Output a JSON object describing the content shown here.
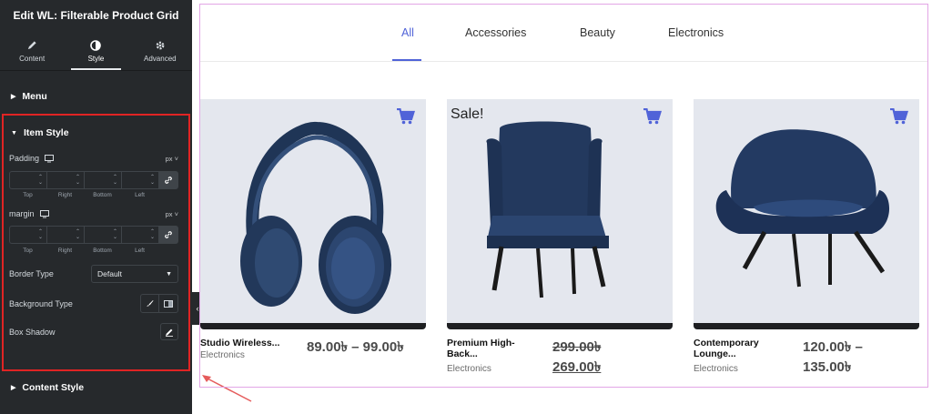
{
  "panel": {
    "title": "Edit WL: Filterable Product Grid",
    "tabs": [
      {
        "label": "Content",
        "icon": "pencil-icon"
      },
      {
        "label": "Style",
        "icon": "half-circle-icon"
      },
      {
        "label": "Advanced",
        "icon": "gear-icon"
      }
    ],
    "sections": {
      "menu": "Menu",
      "item_style": "Item Style",
      "content_style": "Content Style"
    },
    "controls": {
      "padding_label": "Padding",
      "margin_label": "margin",
      "unit": "px",
      "dim_labels": [
        "Top",
        "Right",
        "Bottom",
        "Left"
      ],
      "border_type_label": "Border Type",
      "border_type_value": "Default",
      "background_type_label": "Background Type",
      "box_shadow_label": "Box Shadow"
    }
  },
  "preview": {
    "filters": [
      "All",
      "Accessories",
      "Beauty",
      "Electronics"
    ],
    "active_filter": "All",
    "accent_color": "#5063d8",
    "products": [
      {
        "name": "Studio Wireless...",
        "category": "Electronics",
        "price_range": "89.00৳ – 99.00৳",
        "sale": ""
      },
      {
        "name_line1": "Premium High-",
        "name_line2": "Back...",
        "category": "Electronics",
        "old_price": "299.00৳",
        "new_price": "269.00৳",
        "sale": "Sale!"
      },
      {
        "name_line1": "Contemporary",
        "name_line2": "Lounge...",
        "category": "Electronics",
        "price_line1": "120.00৳ –",
        "price_line2": "135.00৳",
        "sale": ""
      }
    ]
  }
}
